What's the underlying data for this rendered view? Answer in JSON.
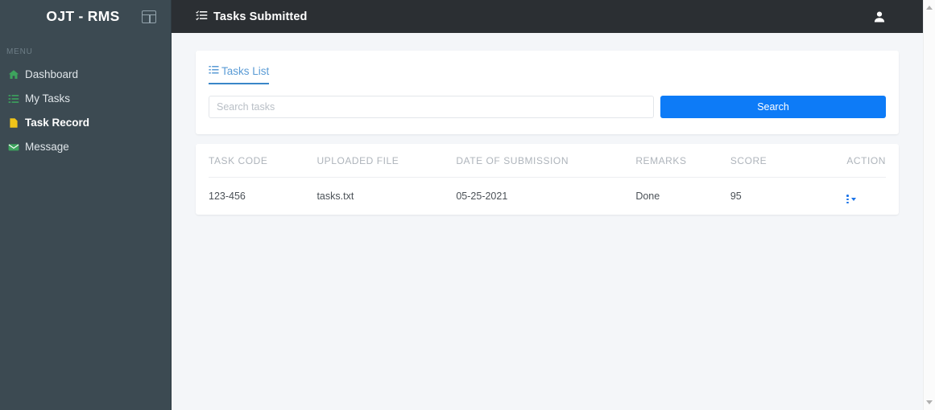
{
  "sidebar": {
    "brand": "OJT - RMS",
    "toggle_icon": "grid-toggle-icon",
    "menu_label": "MENU",
    "items": [
      {
        "label": "Dashboard",
        "icon": "home-icon",
        "icon_color": "#3da35d",
        "active": false
      },
      {
        "label": "My Tasks",
        "icon": "list-icon",
        "icon_color": "#3da35d",
        "active": false
      },
      {
        "label": "Task Record",
        "icon": "file-icon",
        "icon_color": "#f0c419",
        "active": true
      },
      {
        "label": "Message",
        "icon": "envelope-icon",
        "icon_color": "#3da35d",
        "active": false
      }
    ]
  },
  "topbar": {
    "title": "Tasks Submitted",
    "title_icon": "tasks-list-icon",
    "user_icon": "user-icon"
  },
  "tabs": [
    {
      "label": "Tasks List",
      "icon": "list-icon",
      "active": true
    }
  ],
  "search": {
    "placeholder": "Search tasks",
    "value": "",
    "button_label": "Search"
  },
  "table": {
    "columns": [
      "TASK CODE",
      "UPLOADED FILE",
      "DATE OF SUBMISSION",
      "REMARKS",
      "SCORE",
      "ACTION"
    ],
    "rows": [
      {
        "task_code": "123-456",
        "uploaded_file": "tasks.txt",
        "date_of_submission": "05-25-2021",
        "remarks": "Done",
        "score": "95",
        "action_icon": "kebab-menu-icon"
      }
    ]
  },
  "colors": {
    "sidebar_bg": "#3c4a52",
    "topbar_bg": "#2b2f33",
    "content_bg": "#f4f6f9",
    "accent_blue": "#0d7bf7",
    "tab_blue": "#3a86c8",
    "action_blue": "#1a73e8"
  }
}
